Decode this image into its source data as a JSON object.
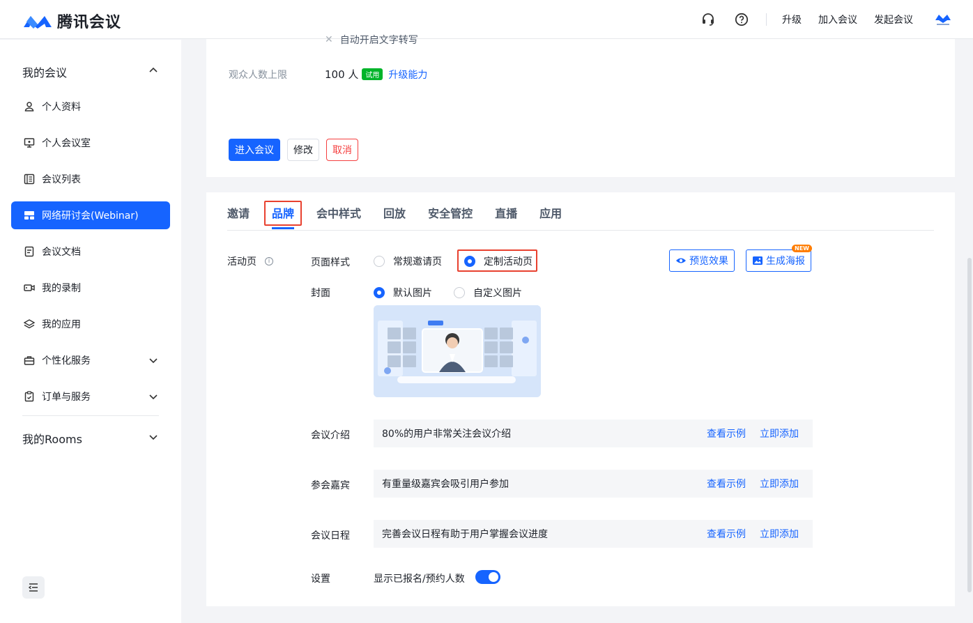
{
  "header": {
    "app_name": "腾讯会议",
    "links": [
      "升级",
      "加入会议",
      "发起会议"
    ],
    "icons": [
      "headset-icon",
      "help-icon",
      "avatar-logo-icon"
    ],
    "brand_color": "#1664ff"
  },
  "sidebar": {
    "group_my_meetings": "我的会议",
    "items": [
      {
        "label": "个人资料",
        "icon": "user-icon"
      },
      {
        "label": "个人会议室",
        "icon": "monitor-icon"
      },
      {
        "label": "会议列表",
        "icon": "list-icon"
      },
      {
        "label": "网络研讨会(Webinar)",
        "icon": "webinar-icon",
        "active": true
      },
      {
        "label": "会议文档",
        "icon": "document-icon"
      },
      {
        "label": "我的录制",
        "icon": "video-icon"
      },
      {
        "label": "我的应用",
        "icon": "layers-icon"
      },
      {
        "label": "个性化服务",
        "icon": "briefcase-icon"
      },
      {
        "label": "订单与服务",
        "icon": "clipboard-icon"
      }
    ],
    "group_rooms": "我的Rooms"
  },
  "top_card": {
    "faded_text": "自动开启文字转写",
    "audience_label": "观众人数上限",
    "audience_value": "100 人",
    "trial_badge": "试用",
    "upgrade_link": "升级能力",
    "buttons": {
      "enter": "进入会议",
      "edit": "修改",
      "cancel": "取消"
    }
  },
  "tabs": [
    "邀请",
    "品牌",
    "会中样式",
    "回放",
    "安全管控",
    "直播",
    "应用"
  ],
  "active_tab": "品牌",
  "brand": {
    "section_label": "活动页",
    "page_style_label": "页面样式",
    "page_style_options": [
      "常规邀请页",
      "定制活动页"
    ],
    "page_style_selected": "定制活动页",
    "preview_button": "预览效果",
    "poster_button": "生成海报",
    "new_badge": "NEW",
    "cover_label": "封面",
    "cover_options": [
      "默认图片",
      "自定义图片"
    ],
    "cover_selected": "默认图片",
    "rows": [
      {
        "label": "会议介绍",
        "text": "80%的用户非常关注会议介绍",
        "example": "查看示例",
        "add": "立即添加"
      },
      {
        "label": "参会嘉宾",
        "text": "有重量级嘉宾会吸引用户参加",
        "example": "查看示例",
        "add": "立即添加"
      },
      {
        "label": "会议日程",
        "text": "完善会议日程有助于用户掌握会议进度",
        "example": "查看示例",
        "add": "立即添加"
      }
    ],
    "settings_label": "设置",
    "settings_toggle_label": "显示已报名/预约人数",
    "settings_toggle_on": true
  }
}
